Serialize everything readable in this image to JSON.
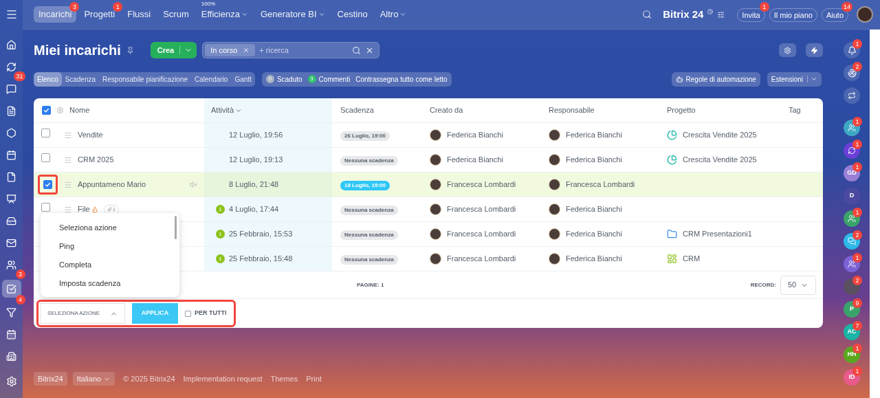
{
  "top_nav": [
    {
      "label": "Incarichi",
      "selected": true,
      "badge": "3",
      "dropdown": false
    },
    {
      "label": "Progetti",
      "selected": false,
      "badge": "1",
      "dropdown": false
    },
    {
      "label": "Flussi",
      "selected": false,
      "dropdown": false
    },
    {
      "label": "Scrum",
      "selected": false,
      "dropdown": false
    },
    {
      "label": "Efficienza",
      "selected": false,
      "caption": "100%",
      "dropdown": true
    },
    {
      "label": "Generatore BI",
      "selected": false,
      "dropdown": true
    },
    {
      "label": "Cestino",
      "selected": false,
      "dropdown": false
    },
    {
      "label": "Altro",
      "selected": false,
      "dropdown": true
    }
  ],
  "header": {
    "brand": "Bitrix 24",
    "buttons": [
      {
        "label": "Invita",
        "badge": "1"
      },
      {
        "label": "Il mio piano"
      },
      {
        "label": "Aiuto",
        "badge": "14"
      }
    ]
  },
  "left_sidebar": [
    {
      "kind": "home",
      "selected": false
    },
    {
      "kind": "loop",
      "selected": false
    },
    {
      "kind": "chat",
      "badge": "31",
      "selected": false
    },
    {
      "kind": "doc",
      "selected": false
    },
    {
      "kind": "hexagon",
      "selected": false
    },
    {
      "kind": "calendar",
      "selected": false
    },
    {
      "kind": "file",
      "selected": false
    },
    {
      "kind": "board",
      "selected": false
    },
    {
      "kind": "drive",
      "selected": false
    },
    {
      "kind": "mail",
      "selected": false
    },
    {
      "kind": "users",
      "selected": false
    },
    {
      "kind": "tasks",
      "badge": "3",
      "selected": true
    },
    {
      "kind": "funnel",
      "badge": "4",
      "selected": false
    },
    {
      "kind": "schedule",
      "selected": false
    },
    {
      "kind": "building",
      "selected": false
    }
  ],
  "page": {
    "title": "Miei incarichi",
    "create": "Crea",
    "filter_chip": "In corso",
    "search": {
      "placeholder": "+ ricerca"
    }
  },
  "views": [
    {
      "label": "Elenco",
      "selected": true
    },
    {
      "label": "Scadenza",
      "selected": false
    },
    {
      "label": "Responsabile pianificazione",
      "selected": false
    },
    {
      "label": "Calendario",
      "selected": false
    },
    {
      "label": "Gantt",
      "selected": false
    }
  ],
  "counters": [
    {
      "count": "0",
      "label": "Scaduto",
      "color": "#a8b3c4"
    },
    {
      "count": "3",
      "label": "Commenti",
      "color": "#2fc26e"
    }
  ],
  "mark_all": "Contrassegna tutto come letto",
  "automation": "Regole di automazione",
  "extensions": "Estensioni",
  "table": {
    "header_checked": true,
    "columns": [
      "Nome",
      "Attività",
      "Scadenza",
      "Creato da",
      "Responsabile",
      "Progetto",
      "Tag"
    ],
    "rows": [
      {
        "name": "Vendite",
        "checked": false,
        "muted": false,
        "hot": false,
        "activity": "12 Luglio, 19:56",
        "deadline": {
          "text": "26 Luglio, 19:00",
          "kind": "date"
        },
        "created_by": "Federica Bianchi",
        "responsible": "Federica Bianchi",
        "project": {
          "name": "Crescita Vendite 2025",
          "kind": "pie"
        }
      },
      {
        "name": "CRM 2025",
        "checked": false,
        "muted": false,
        "hot": false,
        "activity": "12 Luglio, 19:13",
        "deadline": {
          "text": "Nessuna scadenza",
          "kind": "none"
        },
        "created_by": "Federica Bianchi",
        "responsible": "Federica Bianchi",
        "project": {
          "name": "Crescita Vendite 2025",
          "kind": "pie"
        }
      },
      {
        "name": "Appuntameno Mario",
        "checked": true,
        "muted": true,
        "hot": false,
        "activity": "8 Luglio, 21:48",
        "deadline": {
          "text": "18 Luglio, 19:00",
          "kind": "soon"
        },
        "created_by": "Francesca Lombardi",
        "responsible": "Francesca Lombardi"
      },
      {
        "name": "File",
        "checked": false,
        "muted": false,
        "hot": true,
        "files": "1",
        "activity_count": "1",
        "activity": "4 Luglio, 17:44",
        "deadline": {
          "text": "Nessuna scadenza",
          "kind": "none"
        },
        "created_by": "Francesca Lombardi",
        "responsible": "Federica Bianchi"
      },
      {
        "activity_count": "1",
        "activity": "25 Febbraio, 15:53",
        "deadline": {
          "text": "Nessuna scadenza",
          "kind": "none"
        },
        "created_by": "Francesca Lombardi",
        "responsible": "Federica Bianchi",
        "project": {
          "name": "CRM Presentazioni1",
          "kind": "folder"
        }
      },
      {
        "activity_count": "1",
        "activity": "25 Febbraio, 15:48",
        "deadline": {
          "text": "Nessuna scadenza",
          "kind": "none"
        },
        "created_by": "Francesca Lombardi",
        "responsible": "Federica Bianchi",
        "project": {
          "name": "CRM",
          "kind": "board"
        }
      }
    ],
    "pages_label": "PAGINE:",
    "pages": "1",
    "record_label": "RECORD:",
    "record": "50"
  },
  "action_bar": {
    "select": "SELEZIONA AZIONE",
    "expanded": true,
    "options": [
      "Seleziona azione",
      "Ping",
      "Completa",
      "Imposta scadenza"
    ],
    "apply": "APPLICA",
    "for_all": {
      "label": "PER TUTTI",
      "checked": false
    }
  },
  "right_sidebar": [
    {
      "kind": "bell",
      "badge": "1"
    },
    {
      "kind": "radar",
      "badge": "2"
    },
    {
      "kind": "switch"
    },
    {
      "kind": "group",
      "color": "#3ea7c4",
      "badge": "1"
    },
    {
      "kind": "copilot",
      "color": "#6b3fd6",
      "badge": "1"
    },
    {
      "kind": "initials",
      "text": "GD",
      "color": "#9a7fd6",
      "badge": "1"
    },
    {
      "kind": "initials",
      "text": "D",
      "color": "#4a4aa0"
    },
    {
      "kind": "group",
      "color": "#3aa36a",
      "badge": "1"
    },
    {
      "kind": "chat",
      "color": "#2cb8e8",
      "badge": "2"
    },
    {
      "kind": "group",
      "color": "#7b62d6",
      "badge": "1"
    },
    {
      "kind": "photo",
      "color": "#5a5060",
      "badge": "2"
    },
    {
      "kind": "initials",
      "text": "P",
      "color": "#3aa36a",
      "badge": "9"
    },
    {
      "kind": "initials",
      "text": "AC",
      "color": "#1ab3a6",
      "badge": "7"
    },
    {
      "kind": "initials",
      "text": "HH",
      "color": "#5aa81e",
      "badge": "1"
    },
    {
      "kind": "initials",
      "text": "ID",
      "color": "#e85a8a",
      "badge": "1"
    }
  ],
  "footer": {
    "brand": "Bitrix24",
    "language": "Italiano",
    "copyright": "© 2025 Bitrix24",
    "links": [
      "Implementation request",
      "Themes",
      "Print"
    ]
  }
}
